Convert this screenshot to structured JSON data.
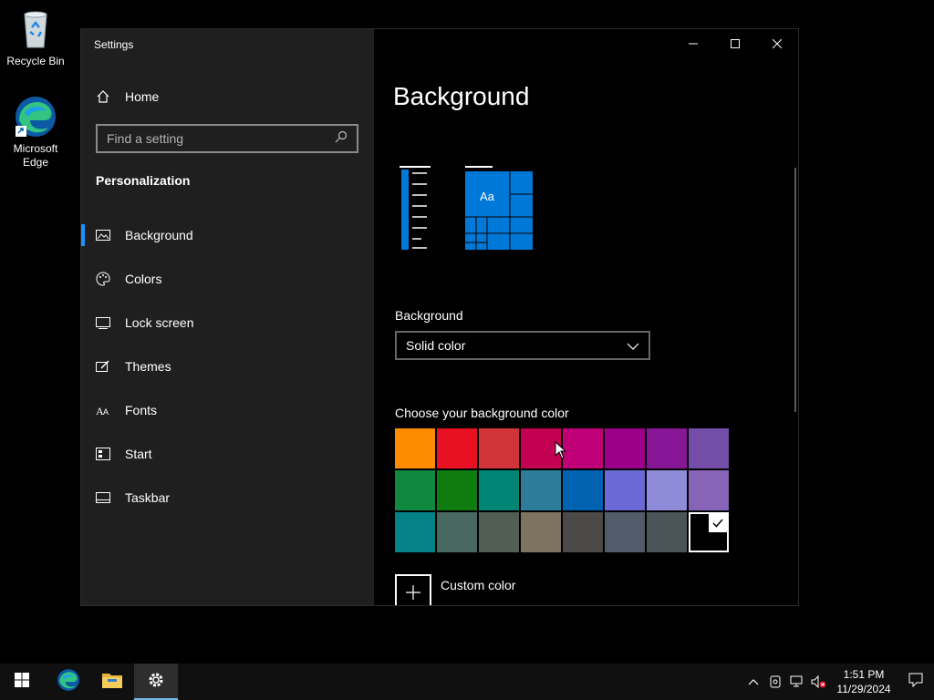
{
  "desktop": {
    "icons": [
      {
        "label": "Recycle Bin"
      },
      {
        "label": "Microsoft Edge"
      }
    ]
  },
  "window": {
    "title": "Settings",
    "sidebar": {
      "home_label": "Home",
      "search_placeholder": "Find a setting",
      "section_title": "Personalization",
      "items": [
        {
          "label": "Background",
          "icon": "picture-icon",
          "active": true
        },
        {
          "label": "Colors",
          "icon": "palette-icon"
        },
        {
          "label": "Lock screen",
          "icon": "lock-screen-icon"
        },
        {
          "label": "Themes",
          "icon": "themes-icon"
        },
        {
          "label": "Fonts",
          "icon": "fonts-icon"
        },
        {
          "label": "Start",
          "icon": "start-icon"
        },
        {
          "label": "Taskbar",
          "icon": "taskbar-icon"
        }
      ]
    },
    "main": {
      "page_title": "Background",
      "preview_text": "Aa",
      "background_label": "Background",
      "background_value": "Solid color",
      "choose_color_label": "Choose your background color",
      "colors": [
        "#ff8c00",
        "#e81123",
        "#d13438",
        "#c30052",
        "#bf0077",
        "#9a0089",
        "#881798",
        "#744da9",
        "#10893e",
        "#107c10",
        "#018574",
        "#2d7d9a",
        "#0063b1",
        "#6b69d6",
        "#8e8cd8",
        "#8764b8",
        "#038387",
        "#486860",
        "#525e54",
        "#7e735f",
        "#4c4a48",
        "#515c6b",
        "#4a5459",
        "#000000"
      ],
      "selected_color_index": 23,
      "custom_color_label": "Custom color"
    }
  },
  "taskbar": {
    "time": "1:51 PM",
    "date": "11/29/2024"
  },
  "accent_color": "#0078d7"
}
